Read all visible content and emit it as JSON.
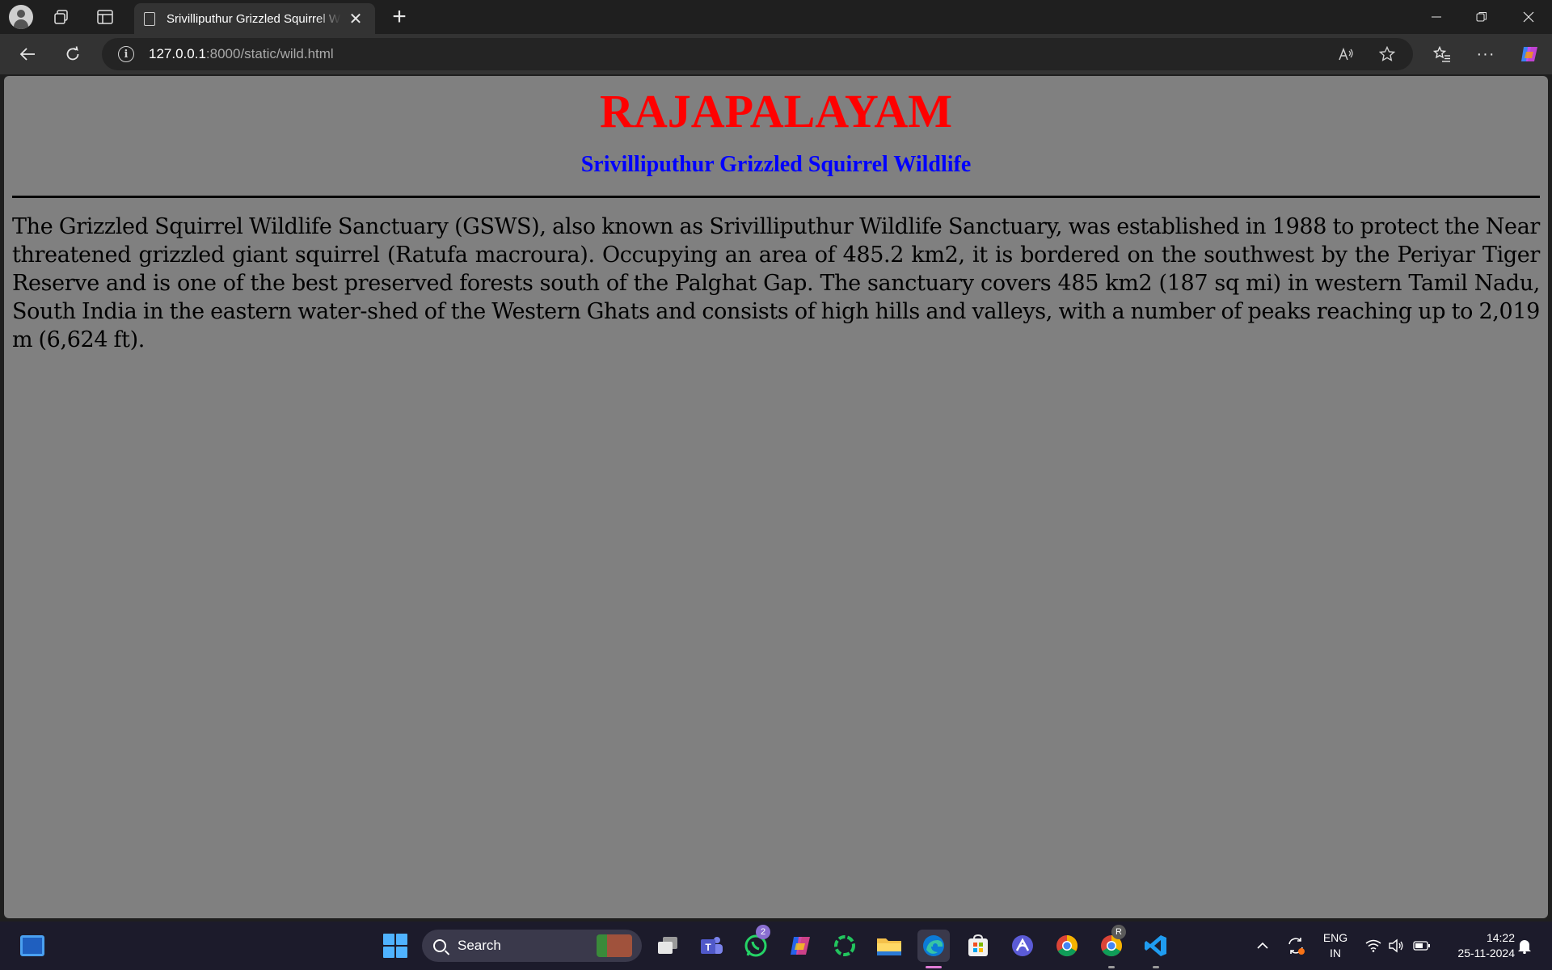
{
  "browser": {
    "tab_title": "Srivilliputhur Grizzled Squirrel Wildlife",
    "url_host": "127.0.0.1",
    "url_path": ":8000/static/wild.html"
  },
  "page": {
    "heading": "RAJAPALAYAM",
    "subheading": "Srivilliputhur Grizzled Squirrel Wildlife",
    "paragraph": "The Grizzled Squirrel Wildlife Sanctuary (GSWS), also known as Srivilliputhur Wildlife Sanctuary, was established in 1988 to protect the Near threatened grizzled giant squirrel (Ratufa macroura). Occupying an area of 485.2 km2, it is bordered on the southwest by the Periyar Tiger Reserve and is one of the best preserved forests south of the Palghat Gap. The sanctuary covers 485 km2 (187 sq mi) in western Tamil Nadu, South India in the eastern water-shed of the Western Ghats and consists of high hills and valleys, with a number of peaks reaching up to 2,019 m (6,624 ft).",
    "colors": {
      "background": "#808080",
      "heading": "#ff0000",
      "subheading": "#0000ff"
    }
  },
  "taskbar": {
    "search_label": "Search",
    "whatsapp_badge": "2",
    "chrome_profile_badge": "R",
    "lang_primary": "ENG",
    "lang_secondary": "IN",
    "time": "14:22",
    "date": "25-11-2024",
    "apps": [
      "widgets-icon",
      "start-icon",
      "task-view-icon",
      "teams-icon",
      "whatsapp-icon",
      "copilot-icon",
      "app-ring-icon",
      "file-explorer-icon",
      "edge-icon",
      "store-icon",
      "arc-icon",
      "chrome-icon",
      "chrome-profile-icon",
      "vscode-icon"
    ]
  }
}
